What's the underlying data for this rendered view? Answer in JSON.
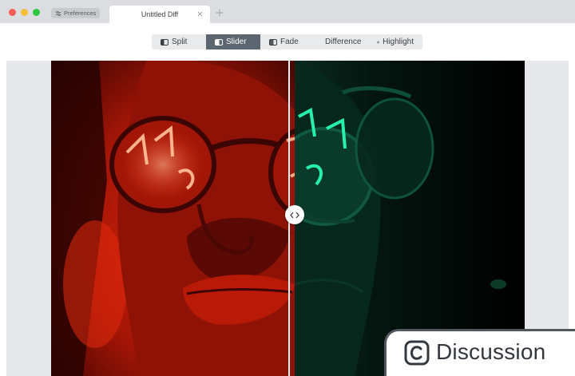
{
  "window": {
    "preferences_label": "Preferences",
    "tab_title": "Untitled Diff"
  },
  "modes": [
    {
      "label": "Split",
      "icon": "split-icon",
      "active": false
    },
    {
      "label": "Slider",
      "icon": "slider-icon",
      "active": true
    },
    {
      "label": "Fade",
      "icon": "fade-icon",
      "active": false
    },
    {
      "label": "Difference",
      "icon": "difference-icon",
      "active": false
    },
    {
      "label": "Highlight",
      "icon": "highlight-icon",
      "active": true
    }
  ],
  "comparison": {
    "left_tint": "#e0260f",
    "right_tint": "#1fd79a",
    "slider_position": 0.516
  },
  "badge": {
    "label": "Discussion",
    "icon": "discussion-c-icon"
  },
  "colors": {
    "active_mode": "#5c6670",
    "canvas_background": "#e6e8eb"
  }
}
